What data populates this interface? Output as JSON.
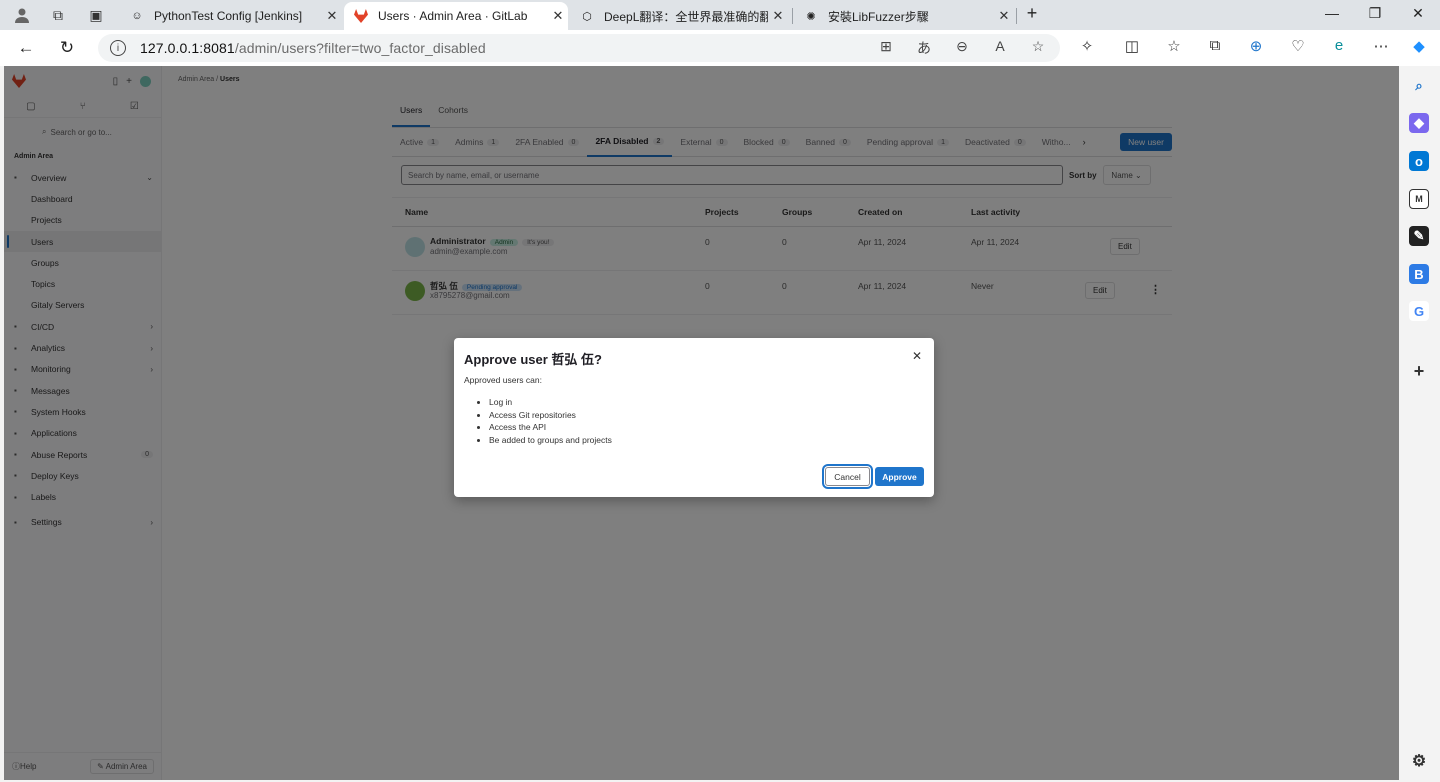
{
  "browser": {
    "tabs": [
      {
        "title": "PythonTest Config [Jenkins]",
        "active": false
      },
      {
        "title": "Users · Admin Area · GitLab",
        "active": true
      },
      {
        "title": "DeepL翻译：全世界最准确的翻译",
        "active": false
      },
      {
        "title": "安裝LibFuzzer步驟",
        "active": false
      }
    ],
    "url_host": "127.0.0.1:8081",
    "url_path": "/admin/users?filter=two_factor_disabled"
  },
  "sidebar": {
    "search_placeholder": "Search or go to...",
    "section": "Admin Area",
    "items": [
      {
        "label": "Overview",
        "icon": "grid-icon",
        "chevron": "⌄",
        "sub": false,
        "current": false
      },
      {
        "label": "Dashboard",
        "sub": true,
        "current": false
      },
      {
        "label": "Projects",
        "sub": true,
        "current": false
      },
      {
        "label": "Users",
        "sub": true,
        "current": true
      },
      {
        "label": "Groups",
        "sub": true,
        "current": false
      },
      {
        "label": "Topics",
        "sub": true,
        "current": false
      },
      {
        "label": "Gitaly Servers",
        "sub": true,
        "current": false
      },
      {
        "label": "CI/CD",
        "icon": "rocket-icon",
        "chevron": "›",
        "sub": false,
        "current": false
      },
      {
        "label": "Analytics",
        "icon": "chart-icon",
        "chevron": "›",
        "sub": false,
        "current": false
      },
      {
        "label": "Monitoring",
        "icon": "monitor-icon",
        "chevron": "›",
        "sub": false,
        "current": false
      },
      {
        "label": "Messages",
        "icon": "megaphone-icon",
        "sub": false,
        "current": false
      },
      {
        "label": "System Hooks",
        "icon": "hook-icon",
        "sub": false,
        "current": false
      },
      {
        "label": "Applications",
        "icon": "apps-icon",
        "sub": false,
        "current": false
      },
      {
        "label": "Abuse Reports",
        "icon": "warning-icon",
        "badge": "0",
        "sub": false,
        "current": false
      },
      {
        "label": "Deploy Keys",
        "icon": "key-icon",
        "sub": false,
        "current": false
      },
      {
        "label": "Labels",
        "icon": "label-icon",
        "sub": false,
        "current": false
      },
      {
        "label": "Settings",
        "icon": "gear-icon",
        "chevron": "›",
        "sub": false,
        "current": false,
        "gap": true
      }
    ],
    "help": "Help",
    "admin_area_button": "Admin Area"
  },
  "breadcrumb": {
    "parent": "Admin Area",
    "current": "Users"
  },
  "main": {
    "top_tabs": [
      {
        "label": "Users",
        "on": true
      },
      {
        "label": "Cohorts",
        "on": false
      }
    ],
    "filter_tabs": [
      {
        "label": "Active",
        "count": "1",
        "on": false
      },
      {
        "label": "Admins",
        "count": "1",
        "on": false
      },
      {
        "label": "2FA Enabled",
        "count": "0",
        "on": false
      },
      {
        "label": "2FA Disabled",
        "count": "2",
        "on": true
      },
      {
        "label": "External",
        "count": "0",
        "on": false
      },
      {
        "label": "Blocked",
        "count": "0",
        "on": false
      },
      {
        "label": "Banned",
        "count": "0",
        "on": false
      },
      {
        "label": "Pending approval",
        "count": "1",
        "on": false
      },
      {
        "label": "Deactivated",
        "count": "0",
        "on": false
      },
      {
        "label": "Witho...",
        "count": "",
        "on": false
      }
    ],
    "new_user": "New user",
    "search_placeholder": "Search by name, email, or username",
    "sort_label": "Sort by",
    "sort_value": "Name",
    "columns": {
      "name": "Name",
      "projects": "Projects",
      "groups": "Groups",
      "created": "Created on",
      "activity": "Last activity"
    },
    "users": [
      {
        "name": "Administrator",
        "badges": [
          "Admin",
          "It's you!"
        ],
        "email": "admin@example.com",
        "projects": "0",
        "groups": "0",
        "created": "Apr 11, 2024",
        "activity": "Apr 11, 2024",
        "edit": "Edit"
      },
      {
        "name": "哲弘 伍",
        "badges": [
          "Pending approval"
        ],
        "email": "x8795278@gmail.com",
        "projects": "0",
        "groups": "0",
        "created": "Apr 11, 2024",
        "activity": "Never",
        "edit": "Edit"
      }
    ]
  },
  "modal": {
    "title": "Approve user 哲弘 伍?",
    "intro": "Approved users can:",
    "bullets": [
      "Log in",
      "Access Git repositories",
      "Access the API",
      "Be added to groups and projects"
    ],
    "cancel": "Cancel",
    "approve": "Approve"
  },
  "colors": {
    "brand_blue": "#1f75cb",
    "gitlab_orange": "#e24329"
  }
}
